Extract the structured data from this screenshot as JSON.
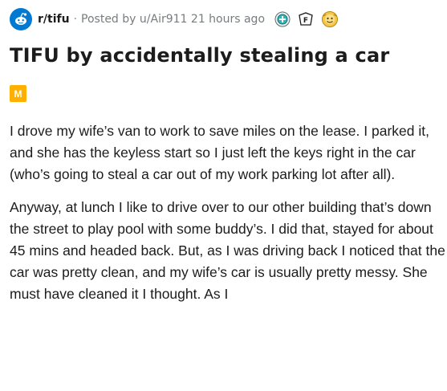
{
  "post": {
    "subreddit": "r/tifu",
    "separator": "·",
    "posted_by_prefix": "Posted by",
    "username": "u/Air911",
    "time_ago": "21 hours ago",
    "title": "TIFU by accidentally stealing a car",
    "flair": "M",
    "paragraphs": [
      "I drove my wife’s van to work to save miles on the lease. I parked it, and she has the keyless start so I just left the keys right in the car (who’s going to steal a car out of my work parking lot after all).",
      "Anyway, at lunch I like to drive over to our other building that’s down the street to play pool with some buddy’s. I did that, stayed for about 45 mins and headed back. But, as I was driving back I noticed that the car was pretty clean, and my wife’s car is usually pretty messy. She must have cleaned it I thought. As I"
    ],
    "awards": [
      {
        "name": "helpful-award-icon",
        "letter": "+"
      },
      {
        "name": "f-award-icon",
        "letter": "F"
      },
      {
        "name": "take-my-energy-award-icon",
        "letter": ""
      }
    ],
    "colors": {
      "brand": "#0079d3",
      "flair": "#ffb000",
      "meta": "#787c7e",
      "text": "#1c1c1c"
    }
  }
}
